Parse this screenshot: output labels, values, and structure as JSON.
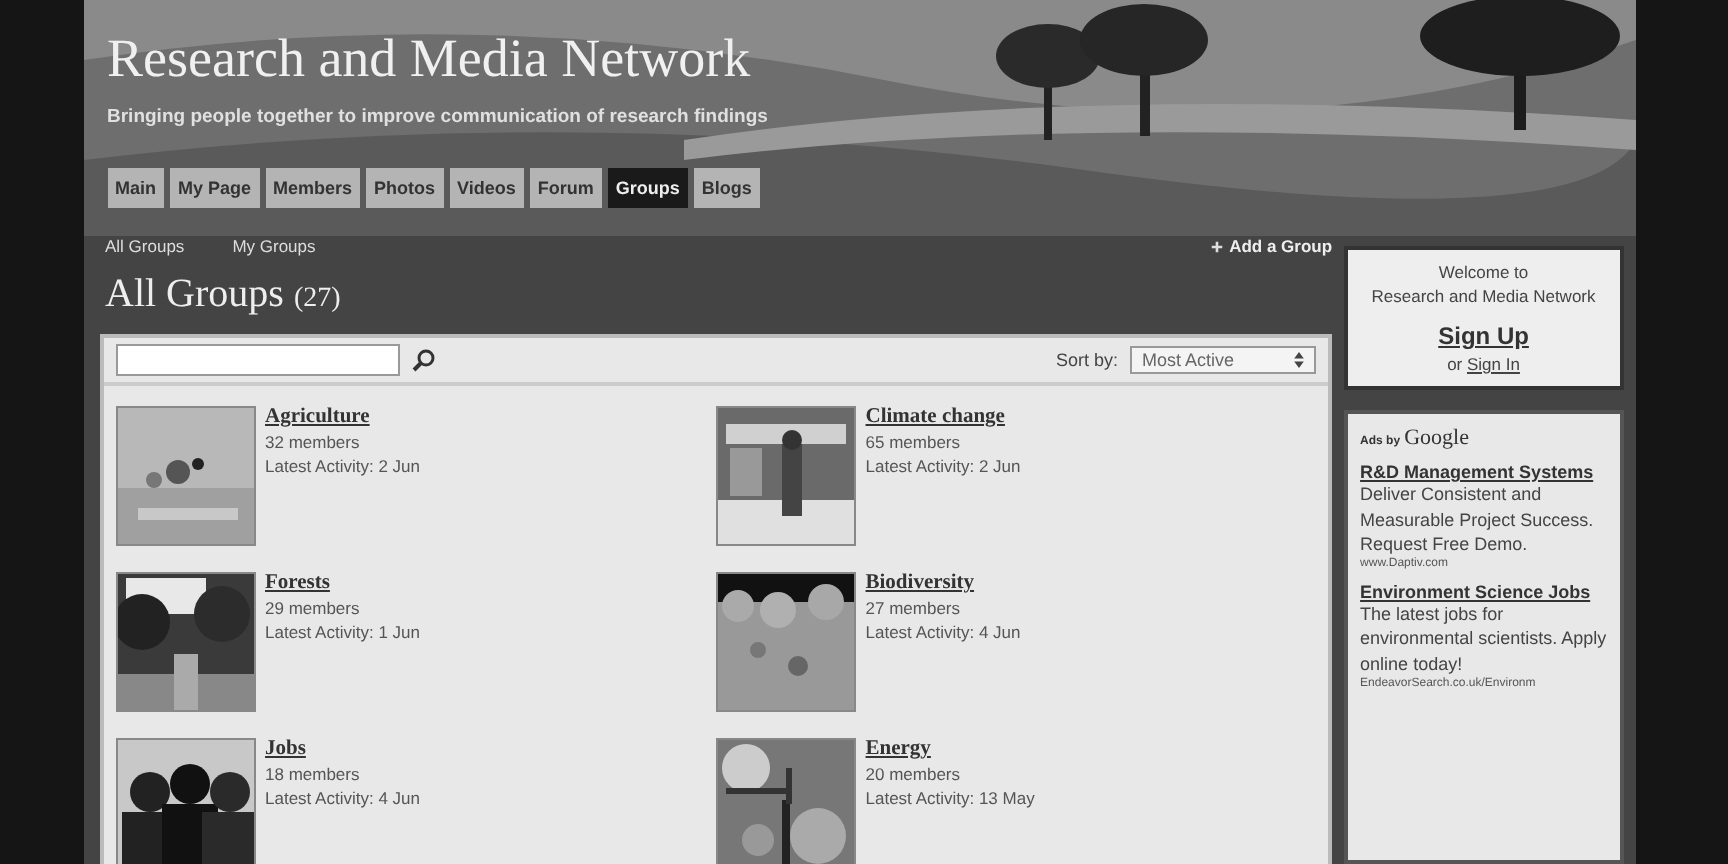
{
  "header": {
    "title": "Research and Media Network",
    "tagline": "Bringing people together to improve communication of research findings"
  },
  "tabs": [
    {
      "label": "Main",
      "selected": false
    },
    {
      "label": "My Page",
      "selected": false
    },
    {
      "label": "Members",
      "selected": false
    },
    {
      "label": "Photos",
      "selected": false
    },
    {
      "label": "Videos",
      "selected": false
    },
    {
      "label": "Forum",
      "selected": false
    },
    {
      "label": "Groups",
      "selected": true
    },
    {
      "label": "Blogs",
      "selected": false
    }
  ],
  "subnav": [
    "All Groups",
    "My Groups"
  ],
  "add_group": "Add a Group",
  "heading": {
    "title": "All Groups",
    "count": "(27)"
  },
  "search": {
    "sort_label": "Sort by:",
    "sort_value": "Most Active"
  },
  "groups": [
    {
      "name": "Agriculture",
      "members": "32 members",
      "activity": "Latest Activity: 2 Jun"
    },
    {
      "name": "Climate change",
      "members": "65 members",
      "activity": "Latest Activity: 2 Jun"
    },
    {
      "name": "Forests",
      "members": "29 members",
      "activity": "Latest Activity: 1 Jun"
    },
    {
      "name": "Biodiversity",
      "members": "27 members",
      "activity": "Latest Activity: 4 Jun"
    },
    {
      "name": "Jobs",
      "members": "18 members",
      "activity": "Latest Activity: 4 Jun"
    },
    {
      "name": "Energy",
      "members": "20 members",
      "activity": "Latest Activity: 13 May"
    }
  ],
  "welcome": {
    "line1": "Welcome to",
    "line2": "Research and Media Network",
    "sign_up": "Sign Up",
    "or": "or",
    "sign_in": "Sign In"
  },
  "ads": {
    "prefix": "Ads by",
    "brand": "Google",
    "items": [
      {
        "title": "R&D Management Systems",
        "text": "Deliver Consistent and Measurable Project Success. Request Free Demo.",
        "url": "www.Daptiv.com"
      },
      {
        "title": "Environment Science Jobs",
        "text": "The latest jobs for environmental scientists. Apply online today!",
        "url": "EndeavorSearch.co.uk/Environm"
      }
    ]
  }
}
